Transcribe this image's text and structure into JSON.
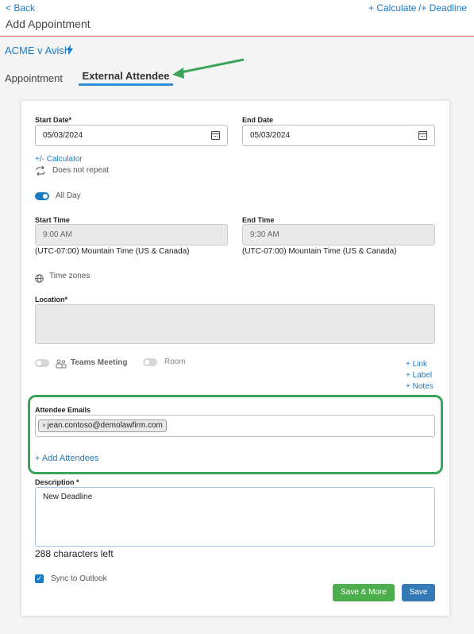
{
  "header": {
    "back_label": "< Back",
    "calculate_label": "+ Calculate",
    "deadline_label": "/+ Deadline",
    "page_title": "Add Appointment"
  },
  "case": {
    "name": "ACME v Avish",
    "icon": "lightning-icon"
  },
  "tabs": [
    {
      "label": "Appointment",
      "active": false
    },
    {
      "label": "External Attendee",
      "active": true
    }
  ],
  "form": {
    "start_date_label": "Start Date*",
    "start_date_value": "05/03/2024",
    "end_date_label": "End Date",
    "end_date_value": "05/03/2024",
    "calculator_link": "+/- Calculator",
    "repeat_label": "Does not repeat",
    "all_day_label": "All Day",
    "all_day_on": true,
    "start_time_label": "Start Time",
    "start_time_value": "9:00 AM",
    "start_timezone": "(UTC-07:00) Mountain Time (US & Canada)",
    "end_time_label": "End Time",
    "end_time_value": "9:30 AM",
    "end_timezone": "(UTC-07:00) Mountain Time (US & Canada)",
    "time_zones_label": "Time zones",
    "location_label": "Location*",
    "location_value": "",
    "teams_label": "Teams Meeting",
    "room_label": "Room",
    "link_label": "+ Link",
    "label_label": "+ Label",
    "notes_label": "+ Notes",
    "attendee_emails_label": "Attendee Emails",
    "attendees": [
      "jean.contoso@demolawfirm.com"
    ],
    "add_attendees_label": "+ Add Attendees",
    "description_label": "Description *",
    "description_value": "New Deadline",
    "chars_left": "288 characters left",
    "sync_label": "Sync to Outlook",
    "sync_checked": true,
    "save_more_label": "Save & More",
    "save_label": "Save"
  },
  "colors": {
    "accent": "#1a7bc4",
    "header_rule": "#d9534f",
    "highlight": "#3ca45a",
    "save_more": "#4cae4c",
    "save": "#337ab7"
  }
}
